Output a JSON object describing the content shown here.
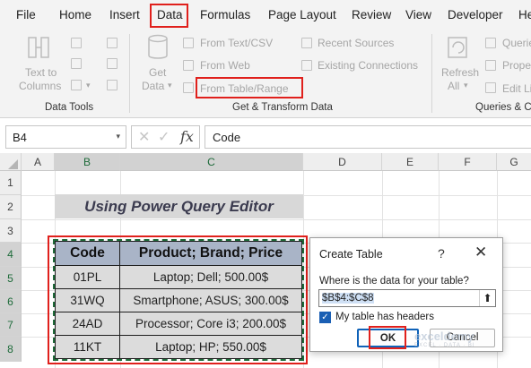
{
  "menu": {
    "tabs": [
      "File",
      "Home",
      "Insert",
      "Data",
      "Formulas",
      "Page Layout",
      "Review",
      "View",
      "Developer",
      "He"
    ],
    "active": "Data"
  },
  "ribbon": {
    "data_tools": {
      "text_to_columns_line1": "Text to",
      "text_to_columns_line2": "Columns",
      "group_label": "Data Tools"
    },
    "get_transform": {
      "get_data_line1": "Get",
      "get_data_line2": "Data",
      "from_text_csv": "From Text/CSV",
      "from_web": "From Web",
      "from_table_range": "From Table/Range",
      "recent_sources": "Recent Sources",
      "existing_connections": "Existing Connections",
      "group_label": "Get & Transform Data"
    },
    "queries": {
      "refresh_line1": "Refresh",
      "refresh_line2": "All",
      "queries_item": "Querie",
      "properties_item": "Prope",
      "edit_links_item": "Edit Li",
      "group_label": "Queries & C"
    }
  },
  "formula_bar": {
    "name_box": "B4",
    "fx_label": "fx",
    "value": "Code"
  },
  "grid": {
    "columns": [
      "A",
      "B",
      "C",
      "D",
      "E",
      "F",
      "G"
    ],
    "rows": [
      "1",
      "2",
      "3",
      "4",
      "5",
      "6",
      "7",
      "8"
    ],
    "title_text": "Using Power Query Editor",
    "table": {
      "headers": [
        "Code",
        "Product; Brand; Price"
      ],
      "rows": [
        [
          "01PL",
          "Laptop; Dell; 500.00$"
        ],
        [
          "31WQ",
          "Smartphone; ASUS; 300.00$"
        ],
        [
          "24AD",
          "Processor; Core i3; 200.00$"
        ],
        [
          "11KT",
          "Laptop; HP; 550.00$"
        ]
      ]
    }
  },
  "dialog": {
    "title": "Create Table",
    "help": "?",
    "close": "✕",
    "prompt": "Where is the data for your table?",
    "range_value": "$B$4:$C$8",
    "checkbox_checked": true,
    "checkbox_label": "My table has headers",
    "ok": "OK",
    "cancel": "Cancel"
  },
  "watermark": {
    "brand": "exceldemy",
    "tagline": "EXCEL · DATA · BI"
  },
  "colors": {
    "highlight_red": "#e0201c",
    "header_fill": "#a9b4c7",
    "cell_fill": "#dcdcdc",
    "title_fill": "#d8d8d8",
    "selection_green": "#1f6b3a",
    "ok_blue": "#0f62b8"
  }
}
